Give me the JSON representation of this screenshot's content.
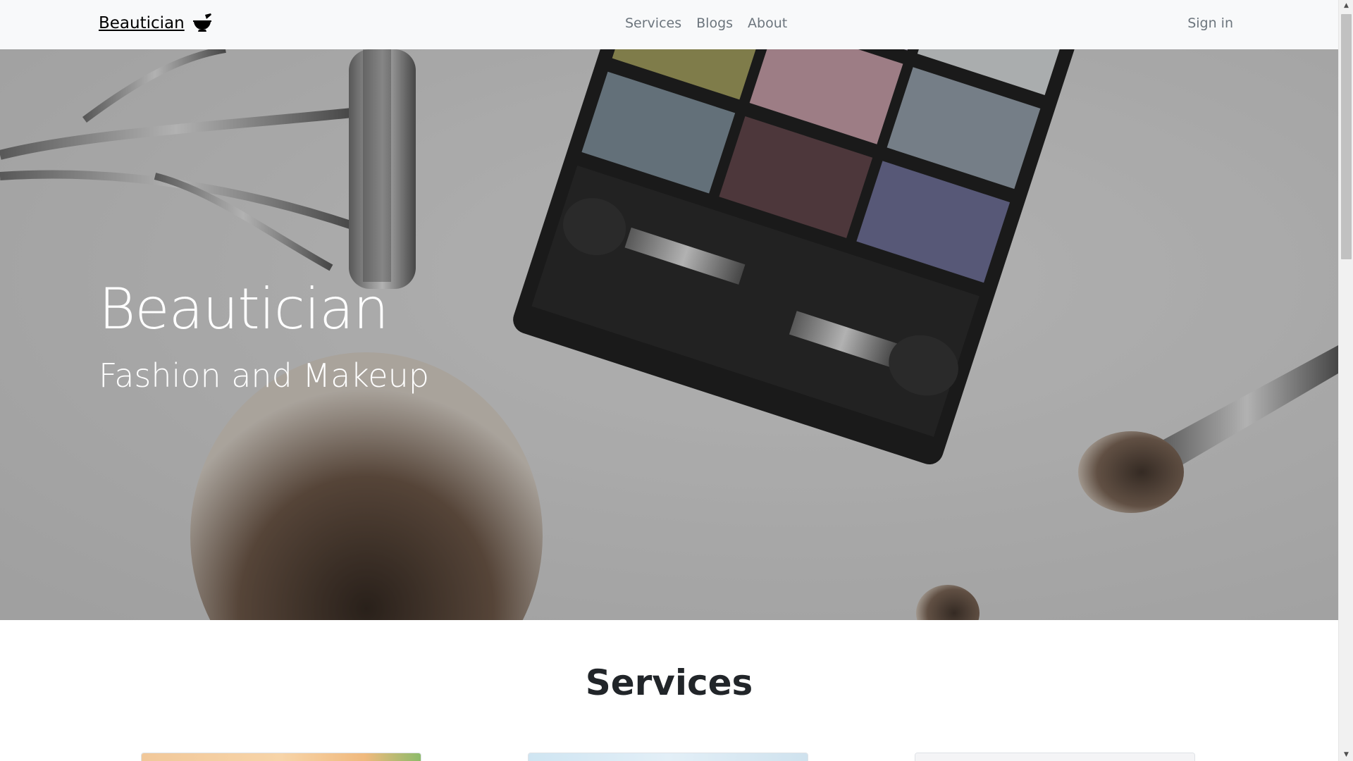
{
  "navbar": {
    "brand": "Beautician",
    "brand_icon": "mortar-pestle-icon",
    "links": [
      {
        "label": "Services"
      },
      {
        "label": "Blogs"
      },
      {
        "label": "About"
      }
    ],
    "signin": "Sign in"
  },
  "hero": {
    "title": "Beautician",
    "subtitle": "Fashion and Makeup",
    "image": "makeup-palette-brushes-photo"
  },
  "services": {
    "title": "Services"
  },
  "colors": {
    "navbar_bg": "#f8f9fa",
    "nav_link": "#6c757d",
    "hero_text": "#ffffff",
    "heading": "#212529"
  }
}
